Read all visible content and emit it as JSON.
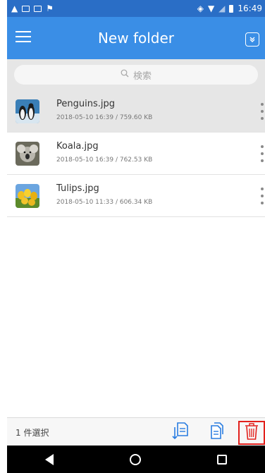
{
  "status_bar": {
    "time": "16:49"
  },
  "app_bar": {
    "title": "New folder",
    "collapse_icon": "double-chevron-down-icon"
  },
  "search": {
    "placeholder": "検索"
  },
  "files": [
    {
      "name": "Penguins.jpg",
      "meta": "2018-05-10 16:39 / 759.60 KB",
      "selected": true,
      "thumb_color": "#2c5a85"
    },
    {
      "name": "Koala.jpg",
      "meta": "2018-05-10 16:39 / 762.53 KB",
      "selected": false,
      "thumb_color": "#7a7a70"
    },
    {
      "name": "Tulips.jpg",
      "meta": "2018-05-10 11:33 / 606.34 KB",
      "selected": false,
      "thumb_color": "#e8b818"
    }
  ],
  "action_bar": {
    "selection_text": "1 件選択"
  },
  "colors": {
    "status_bar": "#2a6ec6",
    "app_bar": "#3a8ee6",
    "accent": "#2a7de1",
    "delete": "#e2201c"
  }
}
